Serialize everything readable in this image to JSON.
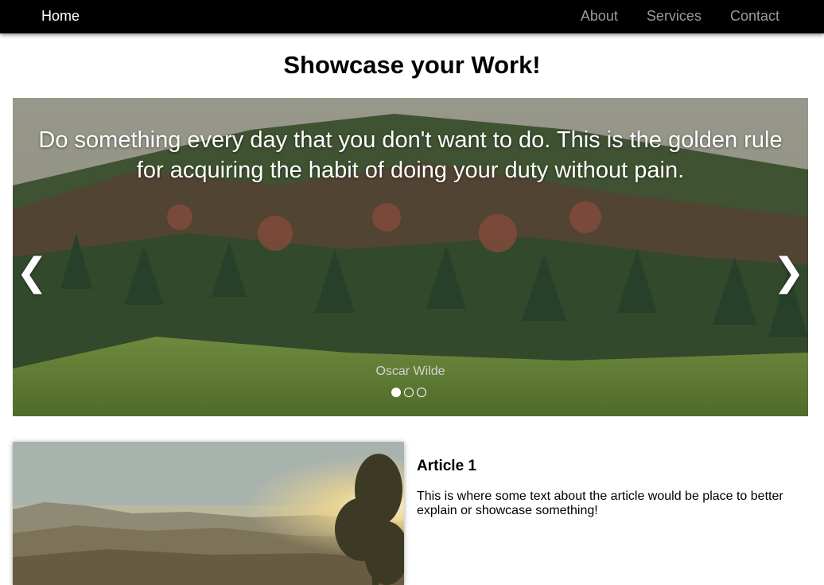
{
  "nav": {
    "home": "Home",
    "links": [
      "About",
      "Services",
      "Contact"
    ]
  },
  "page": {
    "title": "Showcase your Work!"
  },
  "slideshow": {
    "quote": "Do something every day that you don't want to do. This is the golden rule for acquiring the habit of doing your duty without pain.",
    "author": "Oscar Wilde",
    "prev_icon": "❮",
    "next_icon": "❯",
    "slide_count": 3,
    "active_slide": 1
  },
  "article": {
    "heading": "Article 1",
    "text": "This is where some text about the article would be place to better explain or showcase something!"
  },
  "colors": {
    "navbar_bg": "#000000",
    "nav_active": "#ffffff",
    "nav_inactive": "#9a9a9a"
  }
}
